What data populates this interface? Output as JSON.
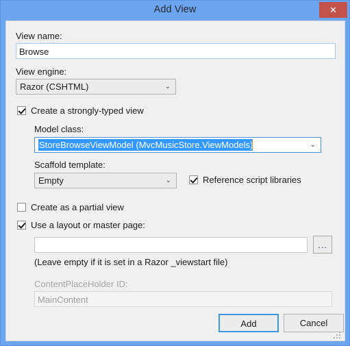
{
  "window": {
    "title": "Add View",
    "close_icon": "close-icon",
    "close_glyph": "✕",
    "titlebar_color": "#6ba5ef",
    "close_button_color": "#c3524a",
    "body_color": "#f0f0f0"
  },
  "fields": {
    "view_name_label": "View name:",
    "view_name_value": "Browse",
    "view_engine_label": "View engine:",
    "view_engine_value": "Razor (CSHTML)",
    "model_class_label": "Model class:",
    "model_class_value": "StoreBrowseViewModel (MvcMusicStore.ViewModels)",
    "scaffold_template_label": "Scaffold template:",
    "scaffold_template_value": "Empty",
    "layout_page_value": "",
    "layout_hint": "(Leave empty if it is set in a Razor _viewstart file)",
    "contentplaceholder_label": "ContentPlaceHolder ID:",
    "contentplaceholder_value": "MainContent",
    "browse_button_label": "...",
    "chevron_glyph": "⌄"
  },
  "checkboxes": {
    "strongly_typed_label": "Create a strongly-typed view",
    "strongly_typed_checked": true,
    "reference_scripts_label": "Reference script libraries",
    "reference_scripts_checked": true,
    "partial_view_label": "Create as a partial view",
    "partial_view_checked": false,
    "use_layout_label": "Use a layout or master page:",
    "use_layout_checked": true
  },
  "buttons": {
    "add_label": "Add",
    "cancel_label": "Cancel"
  },
  "accent": {
    "selection_blue": "#3399ff",
    "focus_border": "#4a90d9"
  }
}
